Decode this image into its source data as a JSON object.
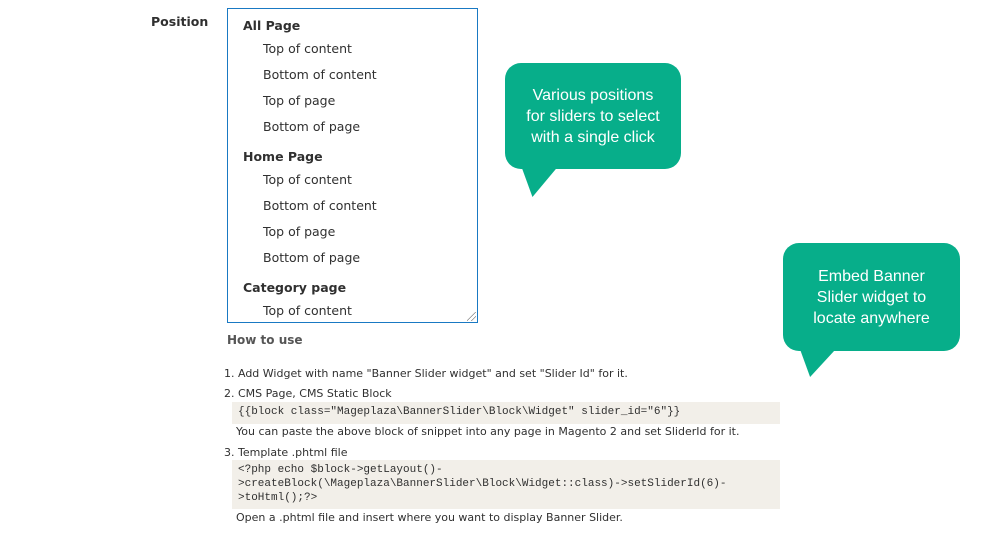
{
  "position_field": {
    "label": "Position",
    "groups": [
      {
        "label": "All Page",
        "options": [
          "Top of content",
          "Bottom of content",
          "Top of page",
          "Bottom of page"
        ]
      },
      {
        "label": "Home Page",
        "options": [
          "Top of content",
          "Bottom of content",
          "Top of page",
          "Bottom of page"
        ]
      },
      {
        "label": "Category page",
        "options": [
          "Top of content"
        ]
      }
    ]
  },
  "how_to_use": {
    "title": "How to use",
    "steps": [
      {
        "label": "1. Add Widget with name \"Banner Slider widget\" and set \"Slider Id\" for it."
      },
      {
        "label": "2. CMS Page, CMS Static Block",
        "code": "{{block class=\"Mageplaza\\BannerSlider\\Block\\Widget\" slider_id=\"6\"}}",
        "note": "You can paste the above block of snippet into any page in Magento 2 and set SliderId for it."
      },
      {
        "label": "3. Template .phtml file",
        "code": "<?php echo $block->getLayout()-\n>createBlock(\\Mageplaza\\BannerSlider\\Block\\Widget::class)->setSliderId(6)-\n>toHtml();?>",
        "note": "Open a .phtml file and insert where you want to display Banner Slider."
      }
    ]
  },
  "callouts": [
    {
      "text": "Various positions for sliders to select with a single click",
      "color": "#07ae8a"
    },
    {
      "text": "Embed Banner Slider widget to locate anywhere",
      "color": "#07ae8a"
    }
  ]
}
